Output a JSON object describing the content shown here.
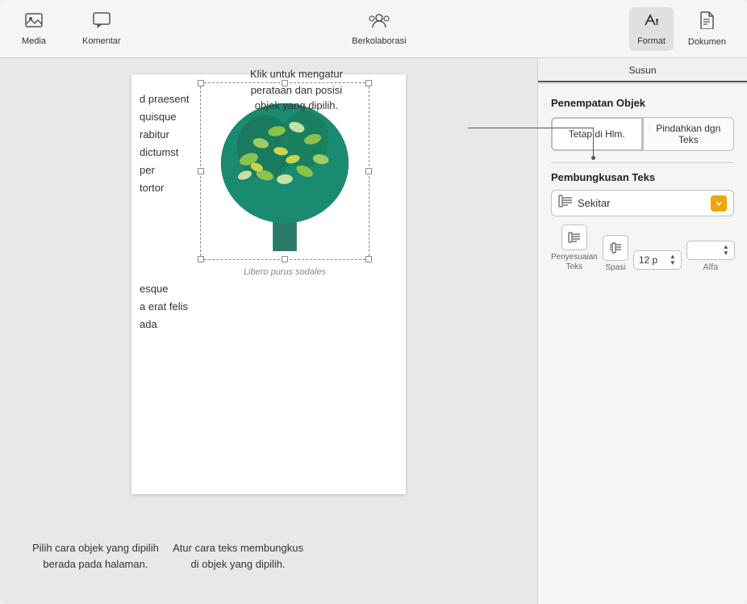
{
  "toolbar": {
    "buttons": [
      {
        "id": "media",
        "label": "Media",
        "icon": "🖼"
      },
      {
        "id": "komentar",
        "label": "Komentar",
        "icon": "💬"
      },
      {
        "id": "berkolaborasi",
        "label": "Berkolaborasi",
        "icon": "👤"
      },
      {
        "id": "format",
        "label": "Format",
        "icon": "🖌",
        "active": true
      },
      {
        "id": "dokumen",
        "label": "Dokumen",
        "icon": "📄"
      }
    ]
  },
  "panel": {
    "tab_label": "Susun",
    "section1_title": "Penempatan Objek",
    "btn_tetap": "Tetap di Hlm.",
    "btn_pindah": "Pindahkan dgn Teks",
    "section2_title": "Pembungkusan Teks",
    "wrap_option": "Sekitar",
    "label_penyesuaian": "Penyesuaian\nTeks",
    "label_spasi": "Spasi",
    "label_alfa": "Alfa",
    "spasi_value": "12 p",
    "alfa_value": ""
  },
  "document": {
    "text_left_lines": [
      "d praesent",
      "quisque",
      "rabitur",
      "dictumst",
      "per",
      "tortor"
    ],
    "text_below_lines": [
      "esque",
      "a erat felis",
      "ada"
    ],
    "caption": "Libero purus sodales"
  },
  "callouts": {
    "top": "Klik untuk mengatur\nperataan dan posisi\nobjek yang dipilih.",
    "bottom_left": "Pilih cara objek yang dipilih\nberada pada halaman.",
    "bottom_right": "Atur cara teks membungkus\ndi objek yang dipilih."
  }
}
